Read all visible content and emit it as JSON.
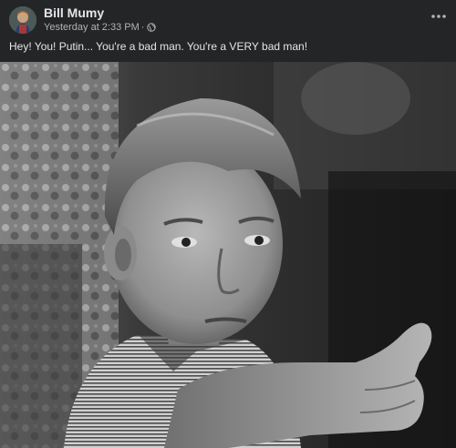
{
  "post": {
    "author": "Bill Mumy",
    "timestamp": "Yesterday at 2:33 PM",
    "separator": "·",
    "audience_icon": "globe-icon",
    "more_icon": "ellipsis-icon",
    "text": "Hey! You! Putin... You're a bad man. You're a VERY bad man!",
    "photo": {
      "style": "black-and-white photograph",
      "subject": "boy pointing at viewer"
    }
  },
  "colors": {
    "background": "#242526",
    "primary_text": "#e4e6eb",
    "secondary_text": "#b0b3b8"
  }
}
